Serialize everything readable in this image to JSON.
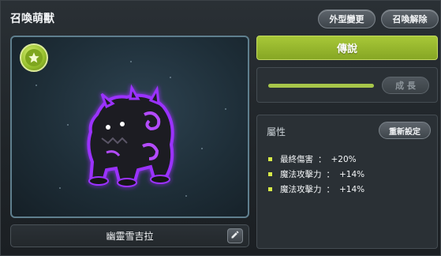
{
  "window": {
    "title": "召喚萌獸"
  },
  "header": {
    "appearance_button": "外型變更",
    "dismiss_button": "召喚解除"
  },
  "pet": {
    "name": "幽靈雪吉拉",
    "grade": "傳說"
  },
  "growth": {
    "button": "成 長",
    "progress": 1.0
  },
  "attributes": {
    "title": "屬性",
    "reset_button": "重新設定",
    "stats": [
      {
        "name": "最終傷害",
        "sep": "：",
        "value": "+20%"
      },
      {
        "name": "魔法攻擊力",
        "sep": "：",
        "value": "+14%"
      },
      {
        "name": "魔法攻擊力",
        "sep": "：",
        "value": "+14%"
      }
    ]
  },
  "colors": {
    "accent_green": "#9ab934",
    "bullet_yellow": "#d7ea48",
    "pet_glow": "#9b33ff"
  },
  "icons": [
    "star-icon",
    "pencil-icon"
  ]
}
